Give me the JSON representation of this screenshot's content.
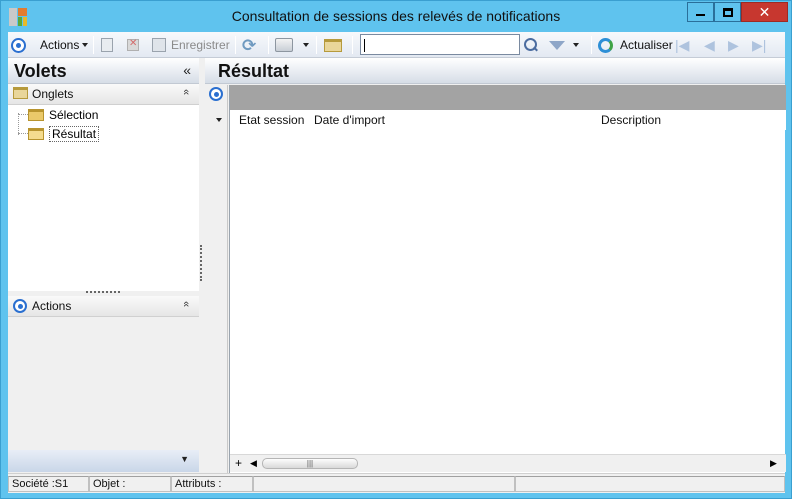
{
  "window": {
    "title": "Consultation de sessions des relevés de notifications",
    "colors": {
      "frame": "#5fc3ee",
      "close_button": "#c7372f"
    }
  },
  "toolbar": {
    "actions_label": "Actions",
    "save_label": "Enregistrer",
    "search_value": "",
    "refresh_label": "Actualiser"
  },
  "left_pane": {
    "title": "Volets",
    "collapse_glyph": "«",
    "tabs_section": {
      "label": "Onglets",
      "chevron": "«",
      "items": [
        {
          "label": "Sélection",
          "selected": false
        },
        {
          "label": "Résultat",
          "selected": true
        }
      ]
    },
    "actions_section": {
      "label": "Actions",
      "chevron": "«"
    },
    "bottom_chevron": "▼"
  },
  "right_pane": {
    "title": "Résultat",
    "grid": {
      "columns": [
        "Etat session",
        "Date d'import",
        "Description"
      ],
      "rows": []
    }
  },
  "status_bar": {
    "societe": "Société :S1",
    "objet": "Objet :",
    "attributs": "Attributs :"
  }
}
